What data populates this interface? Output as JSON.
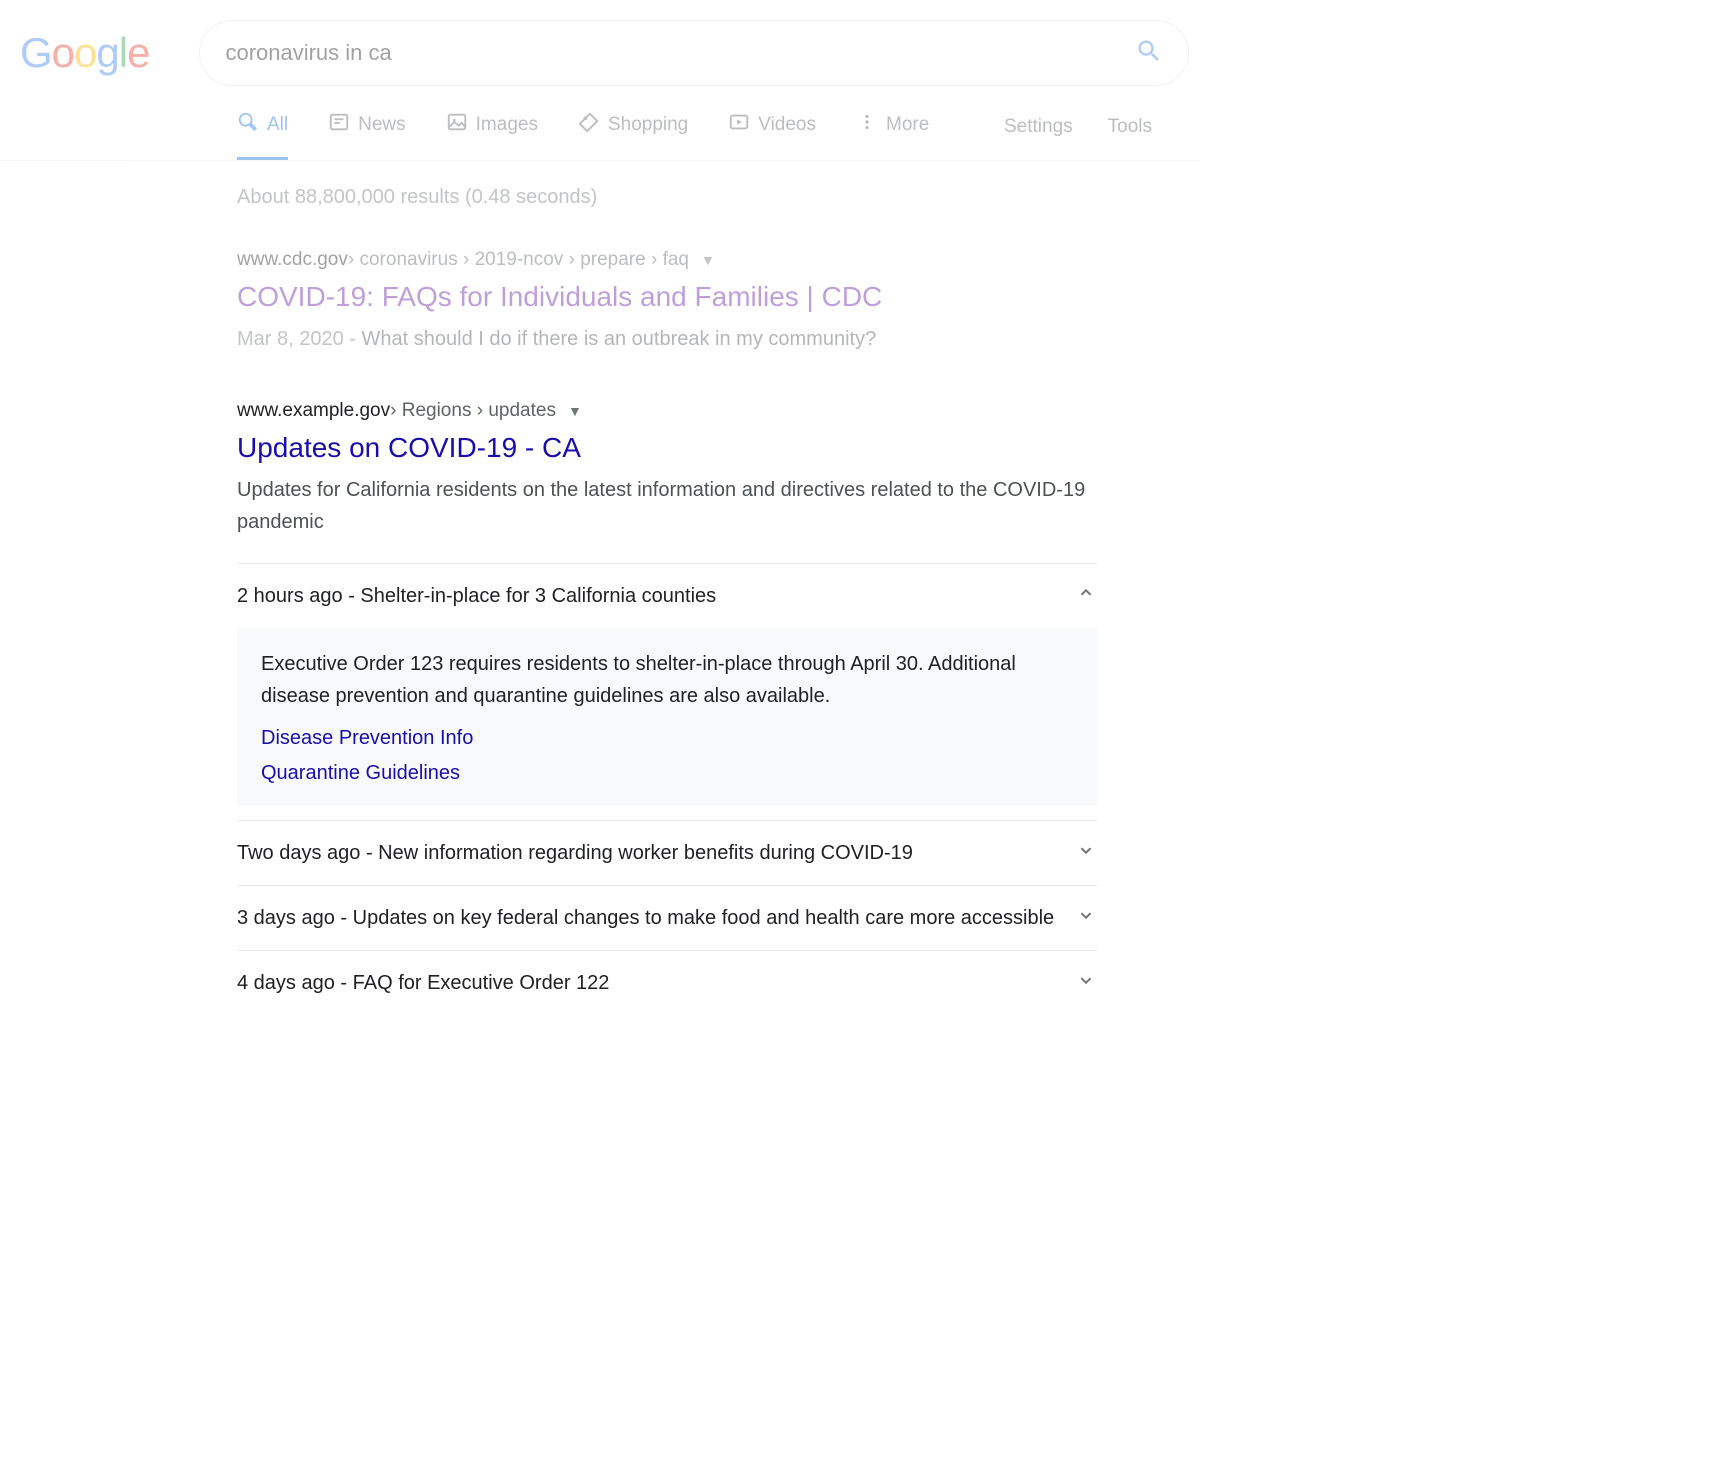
{
  "search": {
    "query": "coronavirus in ca"
  },
  "tabs": {
    "all": "All",
    "news": "News",
    "images": "Images",
    "shopping": "Shopping",
    "videos": "Videos",
    "more": "More"
  },
  "nav_right": {
    "settings": "Settings",
    "tools": "Tools"
  },
  "stats": "About 88,800,000 results (0.48 seconds)",
  "results": [
    {
      "url_domain": "www.cdc.gov",
      "url_path": " › coronavirus › 2019-ncov › prepare › faq",
      "title": "COVID-19: FAQs for Individuals and Families | CDC",
      "visited": true,
      "date": "Mar 8, 2020 - ",
      "snippet": "What should I do if there is an outbreak in my community?"
    },
    {
      "url_domain": "www.example.gov",
      "url_path": " › Regions › updates",
      "title": "Updates on COVID-19 - CA",
      "visited": false,
      "description": "Updates for California residents on the latest information and directives related to the COVID-19 pandemic"
    }
  ],
  "updates": [
    {
      "label": "2 hours ago - Shelter-in-place for 3 California counties",
      "expanded": true,
      "body": "Executive Order 123 requires residents to shelter-in-place through April 30. Additional disease prevention and quarantine guidelines are also available.",
      "links": [
        "Disease Prevention Info",
        "Quarantine Guidelines"
      ]
    },
    {
      "label": "Two days ago - New information regarding worker benefits during COVID-19",
      "expanded": false
    },
    {
      "label": "3 days ago - Updates on key federal changes to make food and health care more accessible",
      "expanded": false
    },
    {
      "label": "4 days ago - FAQ for Executive Order 122",
      "expanded": false
    }
  ]
}
